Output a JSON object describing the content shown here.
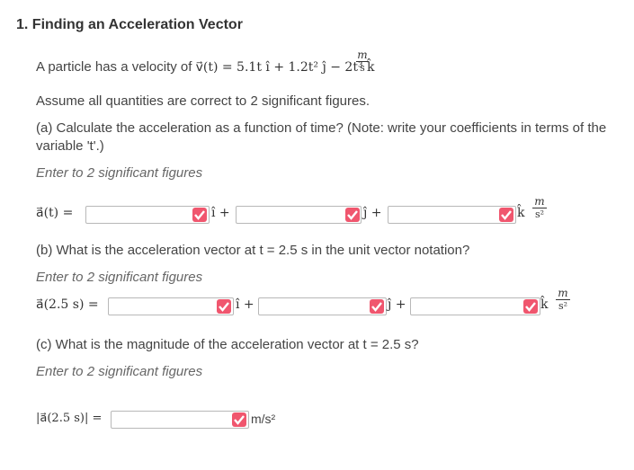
{
  "question": {
    "number_title": "1. Finding an Acceleration Vector",
    "intro_prefix": "A particle has a velocity of ",
    "velocity_expr": "v⃗(t) = 5.1t î + 1.2t² ĵ − 2t³ k̂",
    "velocity_unit_num": "m",
    "velocity_unit_den": "s",
    "assumption": "Assume all quantities are correct to 2 significant figures.",
    "part_a_line1": "(a) Calculate the acceleration as a function of time? (Note: write your coefficients in terms of the",
    "part_a_line2": "variable 't'.)",
    "hint": "Enter to 2 significant figures",
    "part_b": "(b) What is the acceleration vector at t = 2.5 s in the unit vector notation?",
    "part_c": "(c) What is the magnitude of the acceleration vector at t = 2.5 s?"
  },
  "row_a": {
    "label": "a⃗(t) =",
    "i_sep": "î +",
    "j_sep": "ĵ +",
    "k_sep": "k̂",
    "unit_num": "m",
    "unit_den": "s²",
    "inputs": [
      "",
      "",
      ""
    ]
  },
  "row_b": {
    "label": "a⃗(2.5 s) =",
    "i_sep": "î +",
    "j_sep": "ĵ +",
    "k_sep": "k̂",
    "unit_num": "m",
    "unit_den": "s²",
    "inputs": [
      "",
      "",
      ""
    ]
  },
  "row_c": {
    "label": "|a⃗(2.5 s)| =",
    "unit": "m/s²",
    "input": ""
  },
  "colors": {
    "check_bg": "#f0566e",
    "input_border": "#b8b8b8"
  },
  "icons": {
    "check": "checkmark-icon"
  }
}
